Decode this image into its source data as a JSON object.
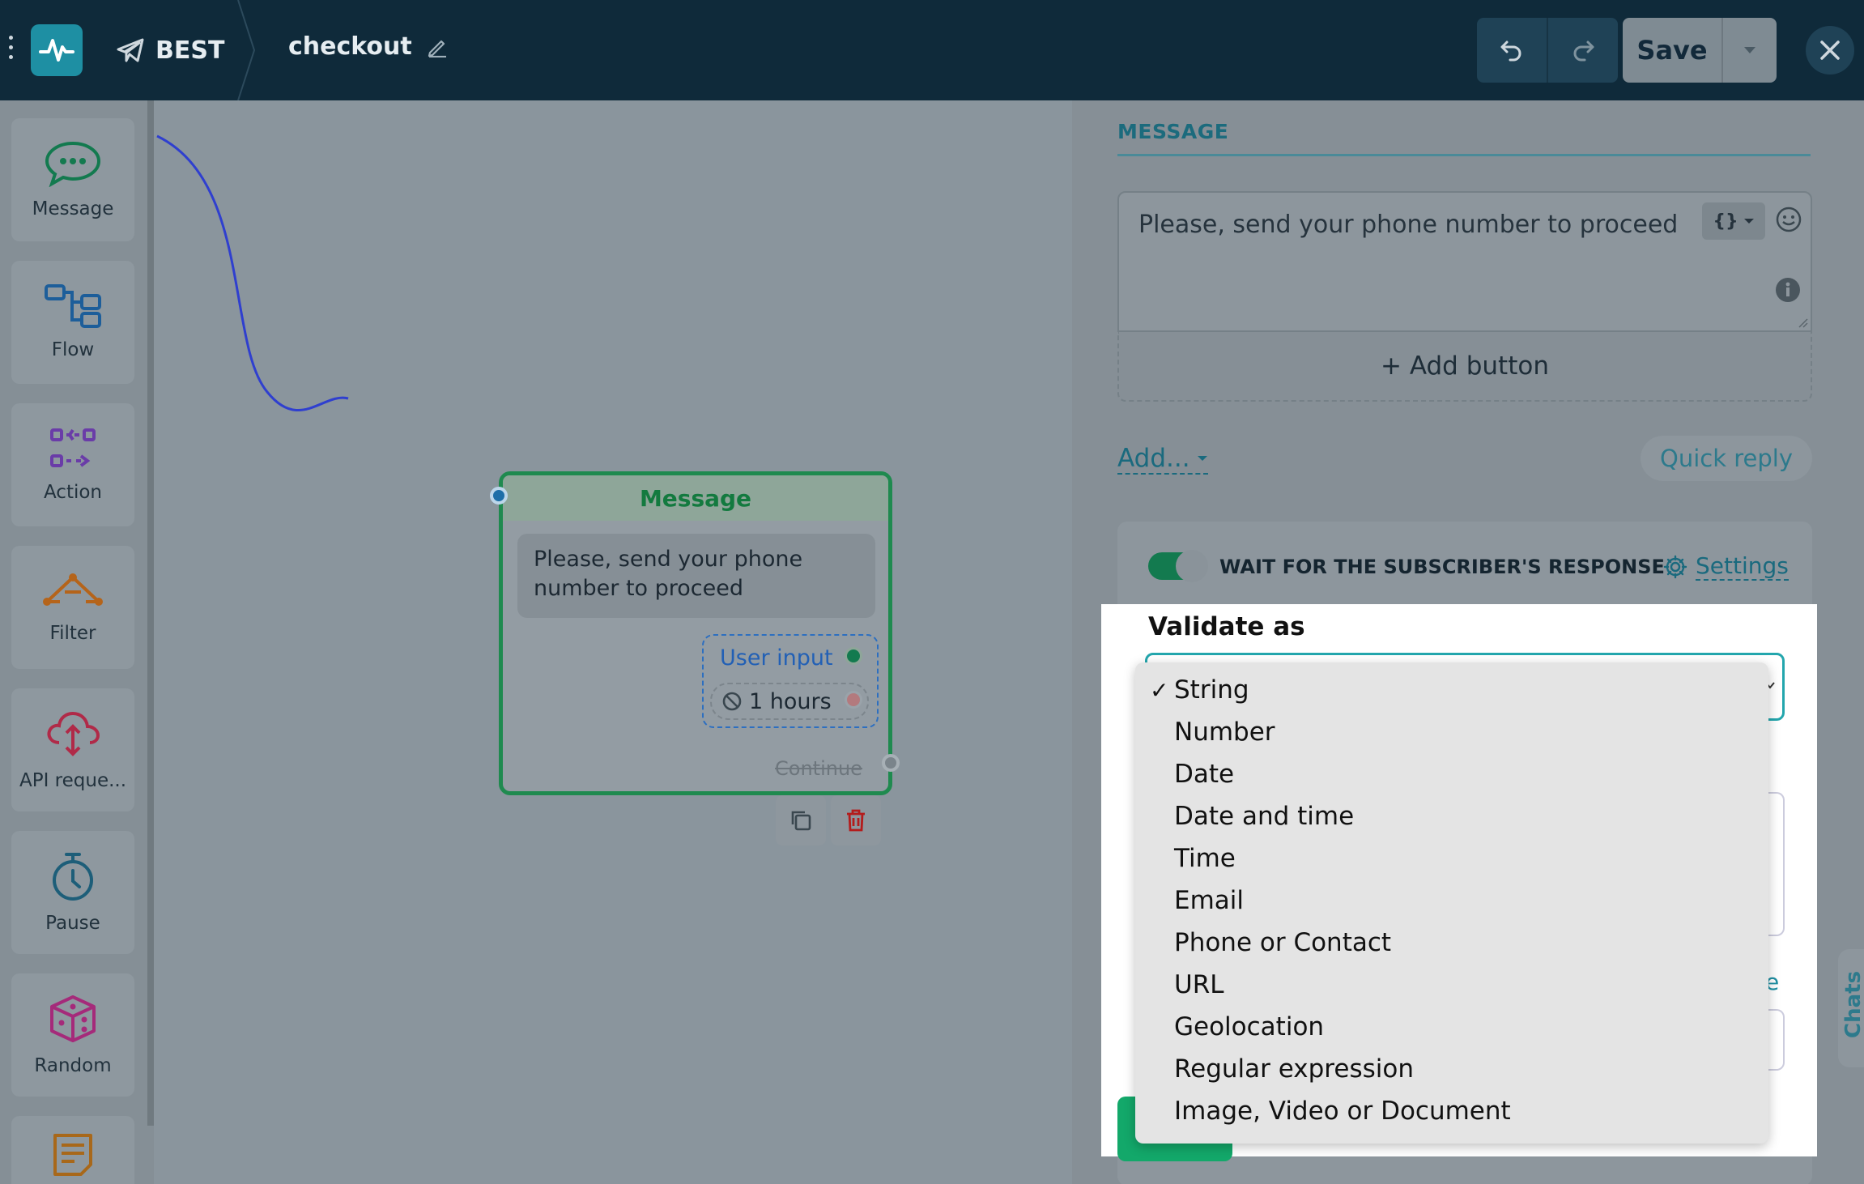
{
  "header": {
    "project_name": "BEST",
    "flow_name": "checkout",
    "save_label": "Save"
  },
  "toolbar": {
    "items": [
      {
        "label": "Message",
        "icon": "message-bubble-icon"
      },
      {
        "label": "Flow",
        "icon": "flow-icon"
      },
      {
        "label": "Action",
        "icon": "action-icon"
      },
      {
        "label": "Filter",
        "icon": "filter-icon"
      },
      {
        "label": "API reque...",
        "icon": "cloud-api-icon"
      },
      {
        "label": "Pause",
        "icon": "stopwatch-icon"
      },
      {
        "label": "Random",
        "icon": "dice-icon"
      }
    ]
  },
  "node": {
    "title": "Message",
    "text": "Please, send your phone number to proceed",
    "user_input_label": "User input",
    "timeout_label": "1 hours",
    "continue_label": "Continue"
  },
  "panel": {
    "tab_label": "MESSAGE",
    "message_text": "Please, send your phone number to proceed",
    "variable_button": "{}",
    "add_button_label": "+ Add button",
    "add_link": "Add...",
    "quick_reply": "Quick reply",
    "wait_label": "WAIT FOR THE SUBSCRIBER'S RESPONSE",
    "settings_label": "Settings",
    "validate_title": "Validate as",
    "partial_link": "e",
    "chats_tab": "Chats"
  },
  "validate_dropdown": {
    "selected": "String",
    "options": [
      "String",
      "Number",
      "Date",
      "Date and time",
      "Time",
      "Email",
      "Phone or Contact",
      "URL",
      "Geolocation",
      "Regular expression",
      "Image, Video or Document"
    ]
  },
  "colors": {
    "topbar": "#0f2a3a",
    "accent": "#1e8fa3",
    "node_border": "#1f8a4f",
    "connector": "#2f3fcf",
    "primary_green": "#13a86a"
  }
}
